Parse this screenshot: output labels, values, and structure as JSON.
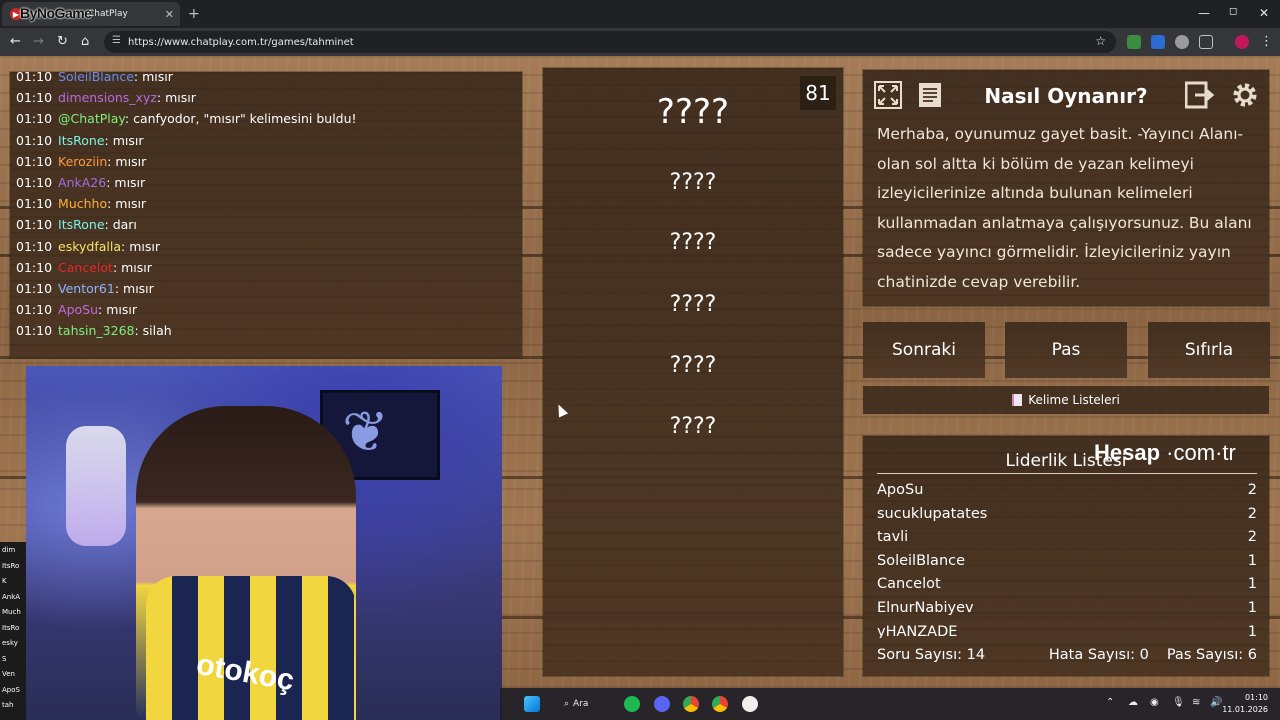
{
  "browser": {
    "tab_title": "ChatPlay",
    "overlay_logo": "ByNoGame",
    "url": "https://www.chatplay.com.tr/games/tahminet",
    "new_tab": "+",
    "tab_close": "✕",
    "window_controls": [
      "—",
      "◻",
      "✕"
    ]
  },
  "chat": {
    "lines": [
      {
        "time": "01:10",
        "user": "SoleilBlance",
        "msg": ": mısır",
        "color": "#6a8ce8"
      },
      {
        "time": "01:10",
        "user": "dimensions_xyz",
        "msg": ": mısır",
        "color": "#b36be0"
      },
      {
        "time": "01:10",
        "user": "@ChatPlay",
        "msg": ": canfyodor, \"mısır\" kelimesini buldu!",
        "color": "#7cf27c"
      },
      {
        "time": "01:10",
        "user": "ItsRone",
        "msg": ": mısır",
        "color": "#7cf2e0"
      },
      {
        "time": "01:10",
        "user": "Keroziin",
        "msg": ": mısır",
        "color": "#ff9a3c"
      },
      {
        "time": "01:10",
        "user": "AnkA26",
        "msg": ": mısır",
        "color": "#a66be0"
      },
      {
        "time": "01:10",
        "user": "Muchho",
        "msg": ": mısır",
        "color": "#ffb13c"
      },
      {
        "time": "01:10",
        "user": "ItsRone",
        "msg": ": darı",
        "color": "#7cf2e0"
      },
      {
        "time": "01:10",
        "user": "eskydfalla",
        "msg": ": mısır",
        "color": "#f4e56b"
      },
      {
        "time": "01:10",
        "user": "Cancelot",
        "msg": ": mısır",
        "color": "#e0282a"
      },
      {
        "time": "01:10",
        "user": "Ventor61",
        "msg": ": mısır",
        "color": "#8ab4ff"
      },
      {
        "time": "01:10",
        "user": "ApoSu",
        "msg": ": mısır",
        "color": "#c06be0"
      },
      {
        "time": "01:10",
        "user": "tahsin_3268",
        "msg": ": silah",
        "color": "#7cf27c"
      }
    ]
  },
  "game": {
    "counter": "81",
    "words": [
      "????",
      "????",
      "????",
      "????",
      "????",
      "????"
    ]
  },
  "how": {
    "title": "Nasıl Oynanır?",
    "text": "Merhaba, oyunumuz gayet basit. -Yayıncı Alanı- olan sol altta ki bölüm de yazan kelimeyi izleyicilerinize altında bulunan kelimeleri kullanmadan anlatmaya çalışıyorsunuz. Bu alanı sadece yayıncı görmelidir. İzleyicileriniz yayın chatinizde cevap verebilir."
  },
  "buttons": {
    "next": "Sonraki",
    "pass": "Pas",
    "reset": "Sıfırla",
    "word_lists": "Kelime Listeleri"
  },
  "leaderboard": {
    "title": "Liderlik Listesi",
    "rows": [
      {
        "name": "ApoSu",
        "score": "2"
      },
      {
        "name": "sucuklupatates",
        "score": "2"
      },
      {
        "name": "tavli",
        "score": "2"
      },
      {
        "name": "SoleilBlance",
        "score": "1"
      },
      {
        "name": "Cancelot",
        "score": "1"
      },
      {
        "name": "ElnurNabiyev",
        "score": "1"
      },
      {
        "name": "yHANZADE",
        "score": "1"
      }
    ],
    "question_count_label": "Soru Sayısı:",
    "question_count": "14",
    "error_count_label": "Hata Sayısı:",
    "error_count": "0",
    "pass_count_label": "Pas Sayısı:",
    "pass_count": "6"
  },
  "overlay": {
    "hesap": "Hesap",
    "dot_com": "com",
    "tr": "tr"
  },
  "webcam": {
    "jersey_text": "otokoç"
  },
  "left_strip": [
    "dim",
    "ItsRo",
    "K",
    "AnkA",
    "Much",
    "ItsRo",
    "esky",
    "S",
    "Ven",
    "ApoS",
    "tah"
  ],
  "taskbar": {
    "search": "Ara",
    "time": "01:10",
    "date": "11.01.2026"
  }
}
